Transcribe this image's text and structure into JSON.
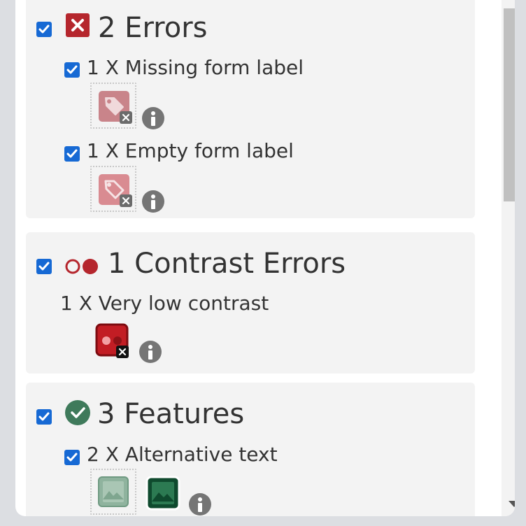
{
  "errors": {
    "title": "2 Errors",
    "items": [
      {
        "label": "1 X Missing form label"
      },
      {
        "label": "1 X Empty form label"
      }
    ]
  },
  "contrast": {
    "title": "1 Contrast Errors",
    "items": [
      {
        "label": "1 X Very low contrast"
      }
    ]
  },
  "features": {
    "title": "3 Features",
    "items": [
      {
        "label": "2 X Alternative text"
      }
    ]
  },
  "colors": {
    "checkbox": "#1669d4",
    "error_red": "#b5262d",
    "feature_green": "#3f7a5b",
    "info_gray": "#757575"
  },
  "icons": {
    "errors_header": "error-x-icon",
    "contrast_header": "contrast-circles-icon",
    "features_header": "check-circle-icon",
    "missing_label": "tag-error-icon",
    "empty_label": "tag-error-icon",
    "low_contrast": "contrast-error-icon",
    "alt_text": "image-icon",
    "info": "info-icon"
  }
}
